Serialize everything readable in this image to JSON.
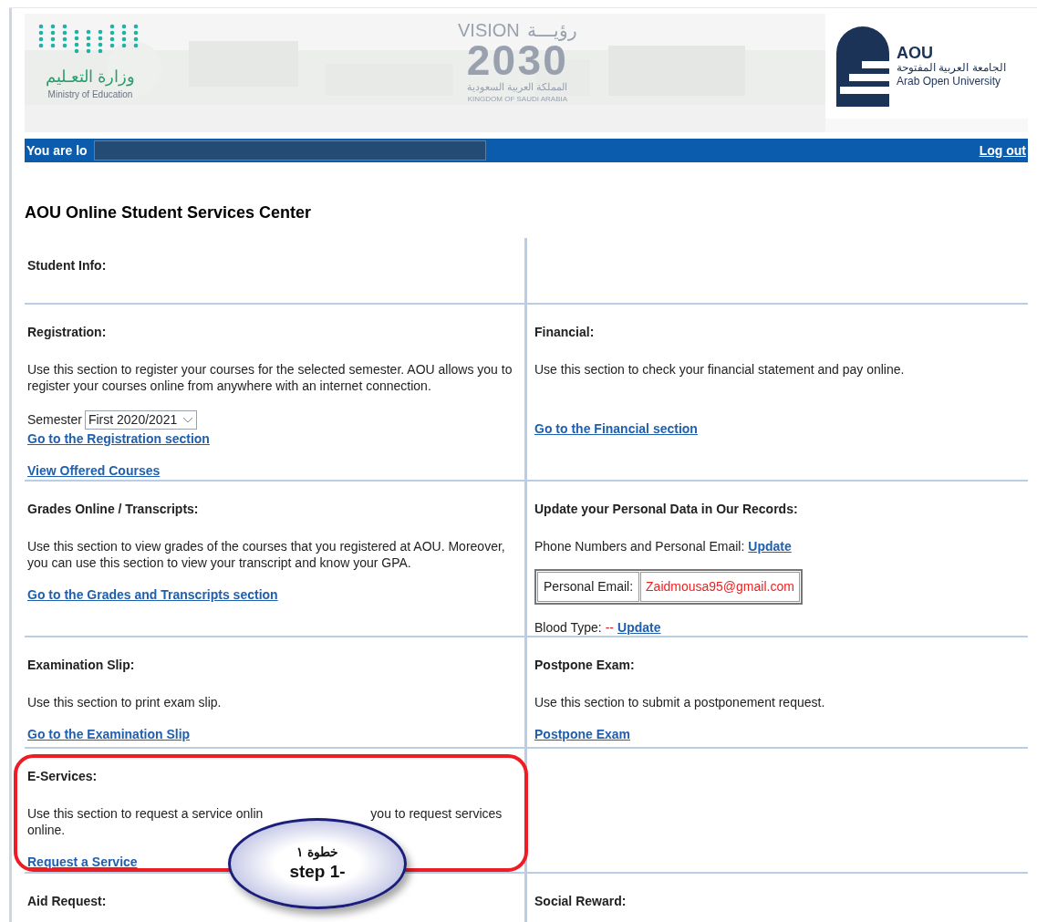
{
  "header": {
    "ministry": {
      "arabic": "وزارة التعـليم",
      "english": "Ministry of Education"
    },
    "vision": {
      "word": "VISION",
      "arabic_word": "رؤيـــة",
      "year": "2030",
      "arabic_country": "المملكة العربية السعودية",
      "country": "KINGDOM OF SAUDI ARABIA"
    },
    "university": {
      "short": "AOU",
      "arabic": "الجامعة العربية المفتوحة",
      "english": "Arab Open University"
    }
  },
  "login_bar": {
    "text": "You are lo",
    "logout": "Log out"
  },
  "title": "AOU Online Student Services Center",
  "rows": [
    {
      "cells": [
        {
          "title": "Student Info:"
        },
        {}
      ]
    },
    {
      "cells": [
        {
          "title": "Registration:",
          "blocks": [
            {
              "kind": "text",
              "text": "Use this section to register your courses for the selected semester. AOU allows you to register your courses online from anywhere with an internet connection."
            },
            {
              "kind": "select",
              "label": "Semester",
              "value": "First 2020/2021"
            },
            {
              "kind": "link",
              "text": "Go to the Registration section"
            },
            {
              "kind": "link",
              "text": "View Offered Courses"
            }
          ]
        },
        {
          "title": "Financial:",
          "blocks": [
            {
              "kind": "text",
              "text": "Use this section to check your financial statement and pay online."
            },
            {
              "kind": "spacer"
            },
            {
              "kind": "link",
              "text": "Go to the Financial section"
            }
          ]
        }
      ]
    },
    {
      "cells": [
        {
          "title": "Grades Online / Transcripts:",
          "blocks": [
            {
              "kind": "text",
              "text": "Use this section to view grades of the courses that you registered at AOU. Moreover, you can use this section to view your transcript and know your GPA."
            },
            {
              "kind": "link",
              "text": "Go to the Grades and Transcripts section"
            }
          ]
        },
        {
          "title": "Update your Personal Data in Our Records:",
          "blocks": [
            {
              "kind": "inline",
              "parts": [
                {
                  "kind": "text",
                  "text": "Phone Numbers and Personal Email:"
                },
                {
                  "kind": "link",
                  "text": "Update"
                }
              ]
            },
            {
              "kind": "table",
              "label": "Personal Email:",
              "value": "Zaidmousa95@gmail.com"
            },
            {
              "kind": "inline",
              "parts": [
                {
                  "kind": "text",
                  "text": "Blood Type:"
                },
                {
                  "kind": "value",
                  "text": "--"
                },
                {
                  "kind": "link",
                  "text": "Update"
                }
              ]
            }
          ]
        }
      ]
    },
    {
      "cells": [
        {
          "title": "Examination Slip:",
          "blocks": [
            {
              "kind": "text",
              "text": "Use this section to print exam slip."
            },
            {
              "kind": "link",
              "text": "Go to the Examination Slip"
            }
          ]
        },
        {
          "title": "Postpone Exam:",
          "blocks": [
            {
              "kind": "text",
              "text": "Use this section to submit a postponement request."
            },
            {
              "kind": "link",
              "text": "Postpone Exam"
            }
          ]
        }
      ]
    },
    {
      "cells": [
        {
          "title": "E-Services:",
          "highlighted": true,
          "blocks": [
            {
              "kind": "lines",
              "lines": [
                [
                  {
                    "kind": "text",
                    "text": "Use this section to request a service onlin"
                  },
                  {
                    "kind": "gap"
                  },
                  {
                    "kind": "text",
                    "text": "you to request services"
                  }
                ],
                [
                  {
                    "kind": "text",
                    "text": "online."
                  }
                ]
              ]
            },
            {
              "kind": "link",
              "text": "Request a Service"
            }
          ]
        },
        {}
      ]
    },
    {
      "cells": [
        {
          "title": "Aid Request:"
        },
        {
          "title": "Social Reward:"
        }
      ]
    }
  ],
  "callout": {
    "arabic": "خطوة ١",
    "english": "step 1-"
  }
}
